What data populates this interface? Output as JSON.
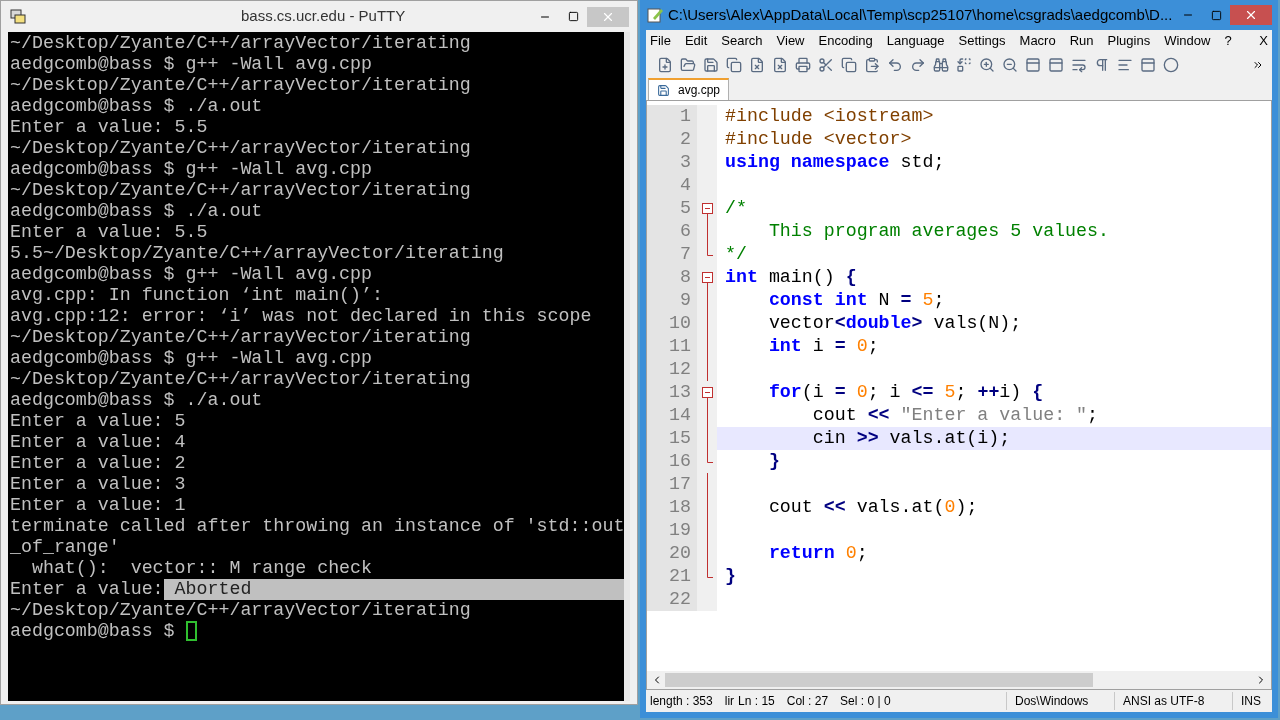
{
  "putty": {
    "title": "bass.cs.ucr.edu - PuTTY",
    "lines": [
      {
        "text": "~/Desktop/Zyante/C++/arrayVector/iterating"
      },
      {
        "text": "aedgcomb@bass $ g++ -Wall avg.cpp"
      },
      {
        "text": "~/Desktop/Zyante/C++/arrayVector/iterating"
      },
      {
        "text": "aedgcomb@bass $ ./a.out"
      },
      {
        "text": "Enter a value: 5.5"
      },
      {
        "text": "~/Desktop/Zyante/C++/arrayVector/iterating"
      },
      {
        "text": "aedgcomb@bass $ g++ -Wall avg.cpp"
      },
      {
        "text": "~/Desktop/Zyante/C++/arrayVector/iterating"
      },
      {
        "text": "aedgcomb@bass $ ./a.out"
      },
      {
        "text": "Enter a value: 5.5"
      },
      {
        "text": "5.5~/Desktop/Zyante/C++/arrayVector/iterating"
      },
      {
        "text": "aedgcomb@bass $ g++ -Wall avg.cpp"
      },
      {
        "text": "avg.cpp: In function ‘int main()’:"
      },
      {
        "text": "avg.cpp:12: error: ‘i’ was not declared in this scope"
      },
      {
        "text": "~/Desktop/Zyante/C++/arrayVector/iterating"
      },
      {
        "text": "aedgcomb@bass $ g++ -Wall avg.cpp"
      },
      {
        "text": "~/Desktop/Zyante/C++/arrayVector/iterating"
      },
      {
        "text": "aedgcomb@bass $ ./a.out"
      },
      {
        "text": "Enter a value: 5"
      },
      {
        "text": "Enter a value: 4"
      },
      {
        "text": "Enter a value: 2"
      },
      {
        "text": "Enter a value: 3"
      },
      {
        "text": "Enter a value: 1"
      },
      {
        "text": "terminate called after throwing an instance of 'std::out"
      },
      {
        "text": "_of_range'"
      },
      {
        "text": "  what():  vector:: M range check"
      },
      {
        "text": "Enter a value:",
        "highlight": " Aborted"
      },
      {
        "text": "~/Desktop/Zyante/C++/arrayVector/iterating"
      },
      {
        "text": "aedgcomb@bass $ ",
        "cursor": true
      }
    ]
  },
  "editor": {
    "title": "C:\\Users\\Alex\\AppData\\Local\\Temp\\scp25107\\home\\csgrads\\aedgcomb\\D...",
    "menu": [
      "File",
      "Edit",
      "Search",
      "View",
      "Encoding",
      "Language",
      "Settings",
      "Macro",
      "Run",
      "Plugins",
      "Window",
      "?"
    ],
    "close_doc": "X",
    "tabs": [
      {
        "label": "avg.cpp",
        "selected": true
      }
    ],
    "code": [
      {
        "n": "1",
        "tokens": [
          {
            "t": "#include <iostream>",
            "kind": "pre"
          }
        ]
      },
      {
        "n": "2",
        "tokens": [
          {
            "t": "#include <vector>",
            "kind": "pre"
          }
        ]
      },
      {
        "n": "3",
        "tokens": [
          {
            "t": "using namespace",
            "kind": "kw"
          },
          {
            "t": " std;",
            "kind": "plain"
          }
        ]
      },
      {
        "n": "4"
      },
      {
        "n": "5",
        "kind": "open",
        "tokens": [
          {
            "t": "/*",
            "kind": "comment"
          }
        ]
      },
      {
        "n": "6",
        "kind": "line",
        "tokens": [
          {
            "t": "    This program averages 5 values.",
            "kind": "comment"
          }
        ]
      },
      {
        "n": "7",
        "kind": "end",
        "tokens": [
          {
            "t": "*/",
            "kind": "comment"
          }
        ]
      },
      {
        "n": "8",
        "kind": "open",
        "tokens": [
          {
            "t": "int",
            "kind": "kw"
          },
          {
            "t": " main() ",
            "kind": "plain"
          },
          {
            "t": "{",
            "kind": "op"
          }
        ]
      },
      {
        "n": "9",
        "kind": "line",
        "tokens": [
          {
            "t": "    const int",
            "kind": "kw"
          },
          {
            "t": " N ",
            "kind": "plain"
          },
          {
            "t": "=",
            "kind": "op"
          },
          {
            "t": " 5",
            "kind": "num"
          },
          {
            "t": ";",
            "kind": "plain"
          }
        ]
      },
      {
        "n": "10",
        "kind": "line",
        "tokens": [
          {
            "t": "    vector",
            "kind": "plain"
          },
          {
            "t": "<",
            "kind": "op"
          },
          {
            "t": "double",
            "kind": "kw"
          },
          {
            "t": ">",
            "kind": "op"
          },
          {
            "t": " vals(N);",
            "kind": "plain"
          }
        ]
      },
      {
        "n": "11",
        "kind": "line",
        "tokens": [
          {
            "t": "    int",
            "kind": "kw"
          },
          {
            "t": " i ",
            "kind": "plain"
          },
          {
            "t": "=",
            "kind": "op"
          },
          {
            "t": " 0",
            "kind": "num"
          },
          {
            "t": ";",
            "kind": "plain"
          }
        ]
      },
      {
        "n": "12",
        "kind": "line"
      },
      {
        "n": "13",
        "kind": "open",
        "tokens": [
          {
            "t": "    for",
            "kind": "kw"
          },
          {
            "t": "(i ",
            "kind": "plain"
          },
          {
            "t": "=",
            "kind": "op"
          },
          {
            "t": " 0",
            "kind": "num"
          },
          {
            "t": "; i ",
            "kind": "plain"
          },
          {
            "t": "<=",
            "kind": "op"
          },
          {
            "t": " 5",
            "kind": "num"
          },
          {
            "t": "; ",
            "kind": "plain"
          },
          {
            "t": "++",
            "kind": "op"
          },
          {
            "t": "i) ",
            "kind": "plain"
          },
          {
            "t": "{",
            "kind": "op"
          }
        ]
      },
      {
        "n": "14",
        "kind": "line",
        "tokens": [
          {
            "t": "        cout ",
            "kind": "plain"
          },
          {
            "t": "<<",
            "kind": "op"
          },
          {
            "t": " \"Enter a value: \"",
            "kind": "str"
          },
          {
            "t": ";",
            "kind": "plain"
          }
        ]
      },
      {
        "n": "15",
        "kind": "line",
        "current": true,
        "tokens": [
          {
            "t": "        cin ",
            "kind": "plain"
          },
          {
            "t": ">>",
            "kind": "op"
          },
          {
            "t": " vals.at(i);",
            "kind": "plain"
          }
        ]
      },
      {
        "n": "16",
        "kind": "end",
        "tokens": [
          {
            "t": "    }",
            "kind": "op"
          }
        ]
      },
      {
        "n": "17",
        "kind": "line"
      },
      {
        "n": "18",
        "kind": "line",
        "tokens": [
          {
            "t": "    cout ",
            "kind": "plain"
          },
          {
            "t": "<<",
            "kind": "op"
          },
          {
            "t": " vals.at(",
            "kind": "plain"
          },
          {
            "t": "0",
            "kind": "num"
          },
          {
            "t": ");",
            "kind": "plain"
          }
        ]
      },
      {
        "n": "19",
        "kind": "line"
      },
      {
        "n": "20",
        "kind": "line",
        "tokens": [
          {
            "t": "    return",
            "kind": "kw"
          },
          {
            "t": " 0",
            "kind": "num"
          },
          {
            "t": ";",
            "kind": "plain"
          }
        ]
      },
      {
        "n": "21",
        "kind": "end",
        "tokens": [
          {
            "t": "}",
            "kind": "op"
          }
        ]
      },
      {
        "n": "22"
      }
    ],
    "status": [
      "length : 353",
      "lir",
      "Ln : 15",
      "Col : 27",
      "Sel : 0 | 0",
      "Dos\\Windows",
      "ANSI as UTF-8",
      "INS"
    ]
  }
}
